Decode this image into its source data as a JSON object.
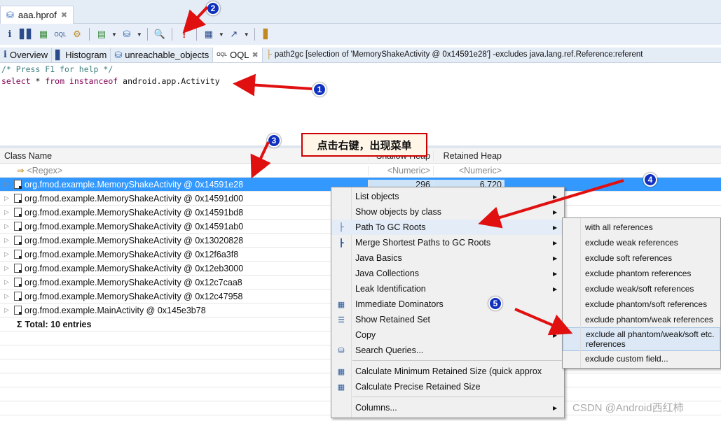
{
  "editor_tab": {
    "title": "aaa.hprof",
    "icon": "database-icon"
  },
  "toolbar": {
    "icons": [
      "info-icon",
      "histogram-icon",
      "dominator-tree-icon",
      "oql-icon",
      "gear-icon",
      "report-icon",
      "query-browser-icon",
      "search-icon",
      "leak-warning-icon",
      "calculator-icon",
      "export-icon",
      "compare-icon"
    ]
  },
  "view_tabs": [
    {
      "label": "Overview",
      "icon": "info-icon"
    },
    {
      "label": "Histogram",
      "icon": "histogram-icon"
    },
    {
      "label": "unreachable_objects",
      "icon": "database-icon"
    },
    {
      "label": "OQL",
      "icon": "oql-icon",
      "active": true
    },
    {
      "label": "path2gc [selection of 'MemoryShakeActivity @ 0x14591e28'] -excludes java.lang.ref.Reference:referent",
      "icon": "tree-icon"
    }
  ],
  "editor": {
    "comment": "/* Press F1 for help */",
    "kw1": "select",
    "star": " * ",
    "kw2": "from",
    "kw3": "instanceof",
    "target": " android.app.Activity"
  },
  "table": {
    "headers": [
      "Class Name",
      "Shallow Heap",
      "Retained Heap"
    ],
    "filter": {
      "regex": "<Regex>",
      "numeric1": "<Numeric>",
      "numeric2": "<Numeric>"
    },
    "rows": [
      {
        "name": "org.fmod.example.MemoryShakeActivity @ 0x14591e28",
        "shallow": "296",
        "retained": "6,720",
        "selected": true
      },
      {
        "name": "org.fmod.example.MemoryShakeActivity @ 0x14591d00"
      },
      {
        "name": "org.fmod.example.MemoryShakeActivity @ 0x14591bd8"
      },
      {
        "name": "org.fmod.example.MemoryShakeActivity @ 0x14591ab0"
      },
      {
        "name": "org.fmod.example.MemoryShakeActivity @ 0x13020828"
      },
      {
        "name": "org.fmod.example.MemoryShakeActivity @ 0x12f6a3f8"
      },
      {
        "name": "org.fmod.example.MemoryShakeActivity @ 0x12eb3000"
      },
      {
        "name": "org.fmod.example.MemoryShakeActivity @ 0x12c7caa8"
      },
      {
        "name": "org.fmod.example.MemoryShakeActivity @ 0x12c47958"
      },
      {
        "name": "org.fmod.example.MainActivity @ 0x145e3b78"
      }
    ],
    "total": "Total: 10 entries"
  },
  "context_menu": {
    "groups": [
      [
        {
          "label": "List objects",
          "sub": true
        },
        {
          "label": "Show objects by class",
          "sub": true
        },
        {
          "label": "Path To GC Roots",
          "sub": true,
          "icon": "path-to-gc-icon",
          "highlighted": true
        },
        {
          "label": "Merge Shortest Paths to GC Roots",
          "sub": true,
          "icon": "merge-paths-icon"
        },
        {
          "label": "Java Basics",
          "sub": true
        },
        {
          "label": "Java Collections",
          "sub": true
        },
        {
          "label": "Leak Identification",
          "sub": true
        },
        {
          "label": "Immediate Dominators",
          "icon": "dominators-icon"
        },
        {
          "label": "Show Retained Set",
          "icon": "retained-set-icon"
        },
        {
          "label": "Copy",
          "sub": true
        },
        {
          "label": "Search Queries...",
          "icon": "database-icon"
        }
      ],
      [
        {
          "label": "Calculate Minimum Retained Size (quick approx",
          "icon": "calculator-icon"
        },
        {
          "label": "Calculate Precise Retained Size",
          "icon": "calculator-icon"
        }
      ],
      [
        {
          "label": "Columns...",
          "sub": true
        }
      ]
    ]
  },
  "submenu": {
    "items": [
      "with all references",
      "exclude weak references",
      "exclude soft references",
      "exclude phantom references",
      "exclude weak/soft references",
      "exclude phantom/soft references",
      "exclude phantom/weak references",
      "exclude all phantom/weak/soft etc. references",
      "exclude custom field..."
    ],
    "highlighted": 7
  },
  "annotations": {
    "callout": "点击右键，出现菜单",
    "badges": [
      "1",
      "2",
      "3",
      "4",
      "5"
    ],
    "arrow_color": "#e01010"
  },
  "watermark": "CSDN @Android西红柿"
}
